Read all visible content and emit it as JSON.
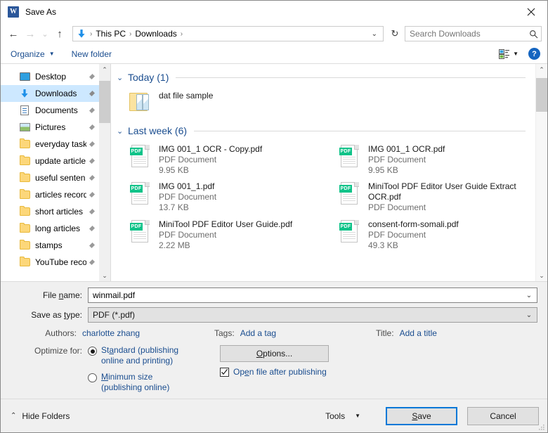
{
  "titlebar": {
    "title": "Save As",
    "app_icon": "word-icon",
    "close_label": "✕"
  },
  "nav": {
    "back": "←",
    "forward": "→",
    "recent": "⌄",
    "up": "↑",
    "address_icon": "downloads-arrow-icon",
    "breadcrumbs": [
      "This PC",
      "Downloads"
    ],
    "separator": "›",
    "address_chevron": "⌄",
    "refresh": "↻",
    "search_placeholder": "Search Downloads",
    "search_value": ""
  },
  "commandbar": {
    "organize": "Organize",
    "organize_caret": "▼",
    "new_folder": "New folder",
    "view_caret": "▼",
    "help": "?"
  },
  "sidebar": {
    "items": [
      {
        "label": "Desktop",
        "icon": "desktop-icon",
        "pinned": true,
        "selected": false
      },
      {
        "label": "Downloads",
        "icon": "downloads-icon",
        "pinned": true,
        "selected": true
      },
      {
        "label": "Documents",
        "icon": "documents-icon",
        "pinned": true,
        "selected": false
      },
      {
        "label": "Pictures",
        "icon": "pictures-icon",
        "pinned": true,
        "selected": false
      },
      {
        "label": "everyday task",
        "icon": "folder-icon",
        "pinned": true,
        "selected": false
      },
      {
        "label": "update article",
        "icon": "folder-icon",
        "pinned": true,
        "selected": false
      },
      {
        "label": "useful senten",
        "icon": "folder-icon",
        "pinned": true,
        "selected": false
      },
      {
        "label": "articles record",
        "icon": "folder-icon",
        "pinned": true,
        "selected": false
      },
      {
        "label": "short articles",
        "icon": "folder-icon",
        "pinned": true,
        "selected": false
      },
      {
        "label": "long articles",
        "icon": "folder-icon",
        "pinned": true,
        "selected": false
      },
      {
        "label": "stamps",
        "icon": "folder-icon",
        "pinned": true,
        "selected": false
      },
      {
        "label": "YouTube reco",
        "icon": "folder-icon",
        "pinned": true,
        "selected": false
      }
    ],
    "scroll_up": "⌃",
    "scroll_down": "⌄"
  },
  "filelist": {
    "groups": [
      {
        "title": "Today (1)",
        "count": 1,
        "chevron": "⌄",
        "items": [
          {
            "name": "dat file sample",
            "type": "",
            "size": "",
            "icon": "folder-documents-icon"
          }
        ]
      },
      {
        "title": "Last week (6)",
        "count": 6,
        "chevron": "⌄",
        "items": [
          {
            "name": "IMG 001_1 OCR - Copy.pdf",
            "type": "PDF Document",
            "size": "9.95 KB",
            "icon": "pdf-icon"
          },
          {
            "name": "IMG 001_1 OCR.pdf",
            "type": "PDF Document",
            "size": "9.95 KB",
            "icon": "pdf-icon"
          },
          {
            "name": "IMG 001_1.pdf",
            "type": "PDF Document",
            "size": "13.7 KB",
            "icon": "pdf-icon"
          },
          {
            "name": "MiniTool PDF Editor User Guide Extract OCR.pdf",
            "type": "PDF Document",
            "size": "",
            "icon": "pdf-icon"
          },
          {
            "name": "MiniTool PDF Editor User Guide.pdf",
            "type": "PDF Document",
            "size": "2.22 MB",
            "icon": "pdf-icon"
          },
          {
            "name": "consent-form-somali.pdf",
            "type": "PDF Document",
            "size": "49.3 KB",
            "icon": "pdf-icon"
          }
        ]
      }
    ],
    "scroll_up": "⌃",
    "scroll_down": "⌄"
  },
  "form": {
    "filename_label": "File name:",
    "filename_value": "winmail.pdf",
    "filetype_label": "Save as type:",
    "filetype_value": "PDF (*.pdf)",
    "chevron": "⌄",
    "authors_label": "Authors:",
    "authors_value": "charlotte zhang",
    "tags_label": "Tags:",
    "tags_value": "Add a tag",
    "title_label": "Title:",
    "title_value": "Add a title",
    "optimize_label": "Optimize for:",
    "optimize_options": [
      {
        "line1": "Standard (publishing",
        "line2": "online and printing)",
        "selected": true
      },
      {
        "line1": "Minimum size",
        "line2": "(publishing online)",
        "selected": false
      }
    ],
    "options_button": "Options...",
    "open_after_label": "Open file after publishing",
    "open_after_checked": true
  },
  "footer": {
    "hide_folders": "Hide Folders",
    "hide_chevron": "⌃",
    "tools": "Tools",
    "tools_caret": "▼",
    "save": "Save",
    "cancel": "Cancel"
  },
  "colors": {
    "accent_blue": "#0078d7",
    "link_blue": "#1a4d8f",
    "selection": "#cde8ff",
    "pdf_green": "#0fc389",
    "folder_yellow": "#fcd77a",
    "dialog_bg": "#f0f0f0"
  }
}
